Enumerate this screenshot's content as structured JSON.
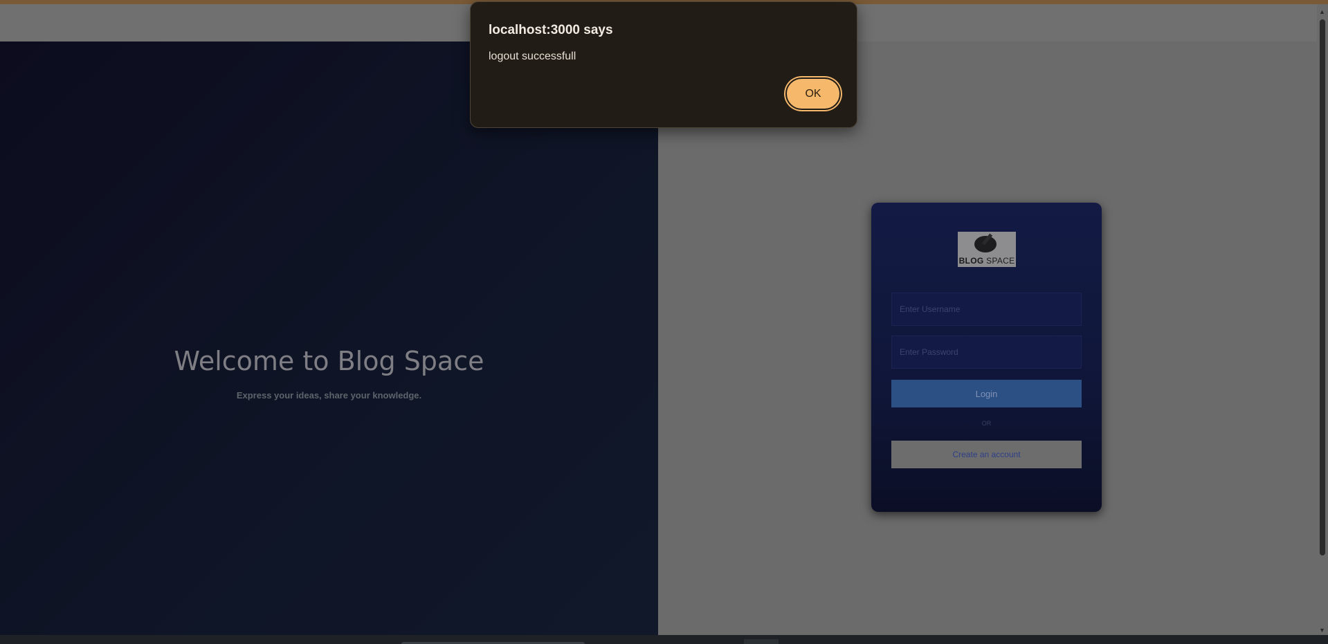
{
  "dialog": {
    "title": "localhost:3000 says",
    "message": "logout successfull",
    "ok_label": "OK"
  },
  "hero": {
    "title": "Welcome to Blog Space",
    "subtitle": "Express your ideas, share your knowledge."
  },
  "login": {
    "logo_text_bold": "BLOG",
    "logo_text_light": "SPACE",
    "username_placeholder": "Enter Username",
    "password_placeholder": "Enter Password",
    "login_label": "Login",
    "or_label": "OR",
    "create_label": "Create an account"
  },
  "colors": {
    "dialog_bg": "#221c16",
    "ok_button": "#f6b86b",
    "card_bg": "#131b45",
    "login_button": "#2c4f84",
    "create_text": "#2d3f86"
  },
  "icons": {
    "scroll_up": "▲",
    "scroll_down": "▼"
  }
}
